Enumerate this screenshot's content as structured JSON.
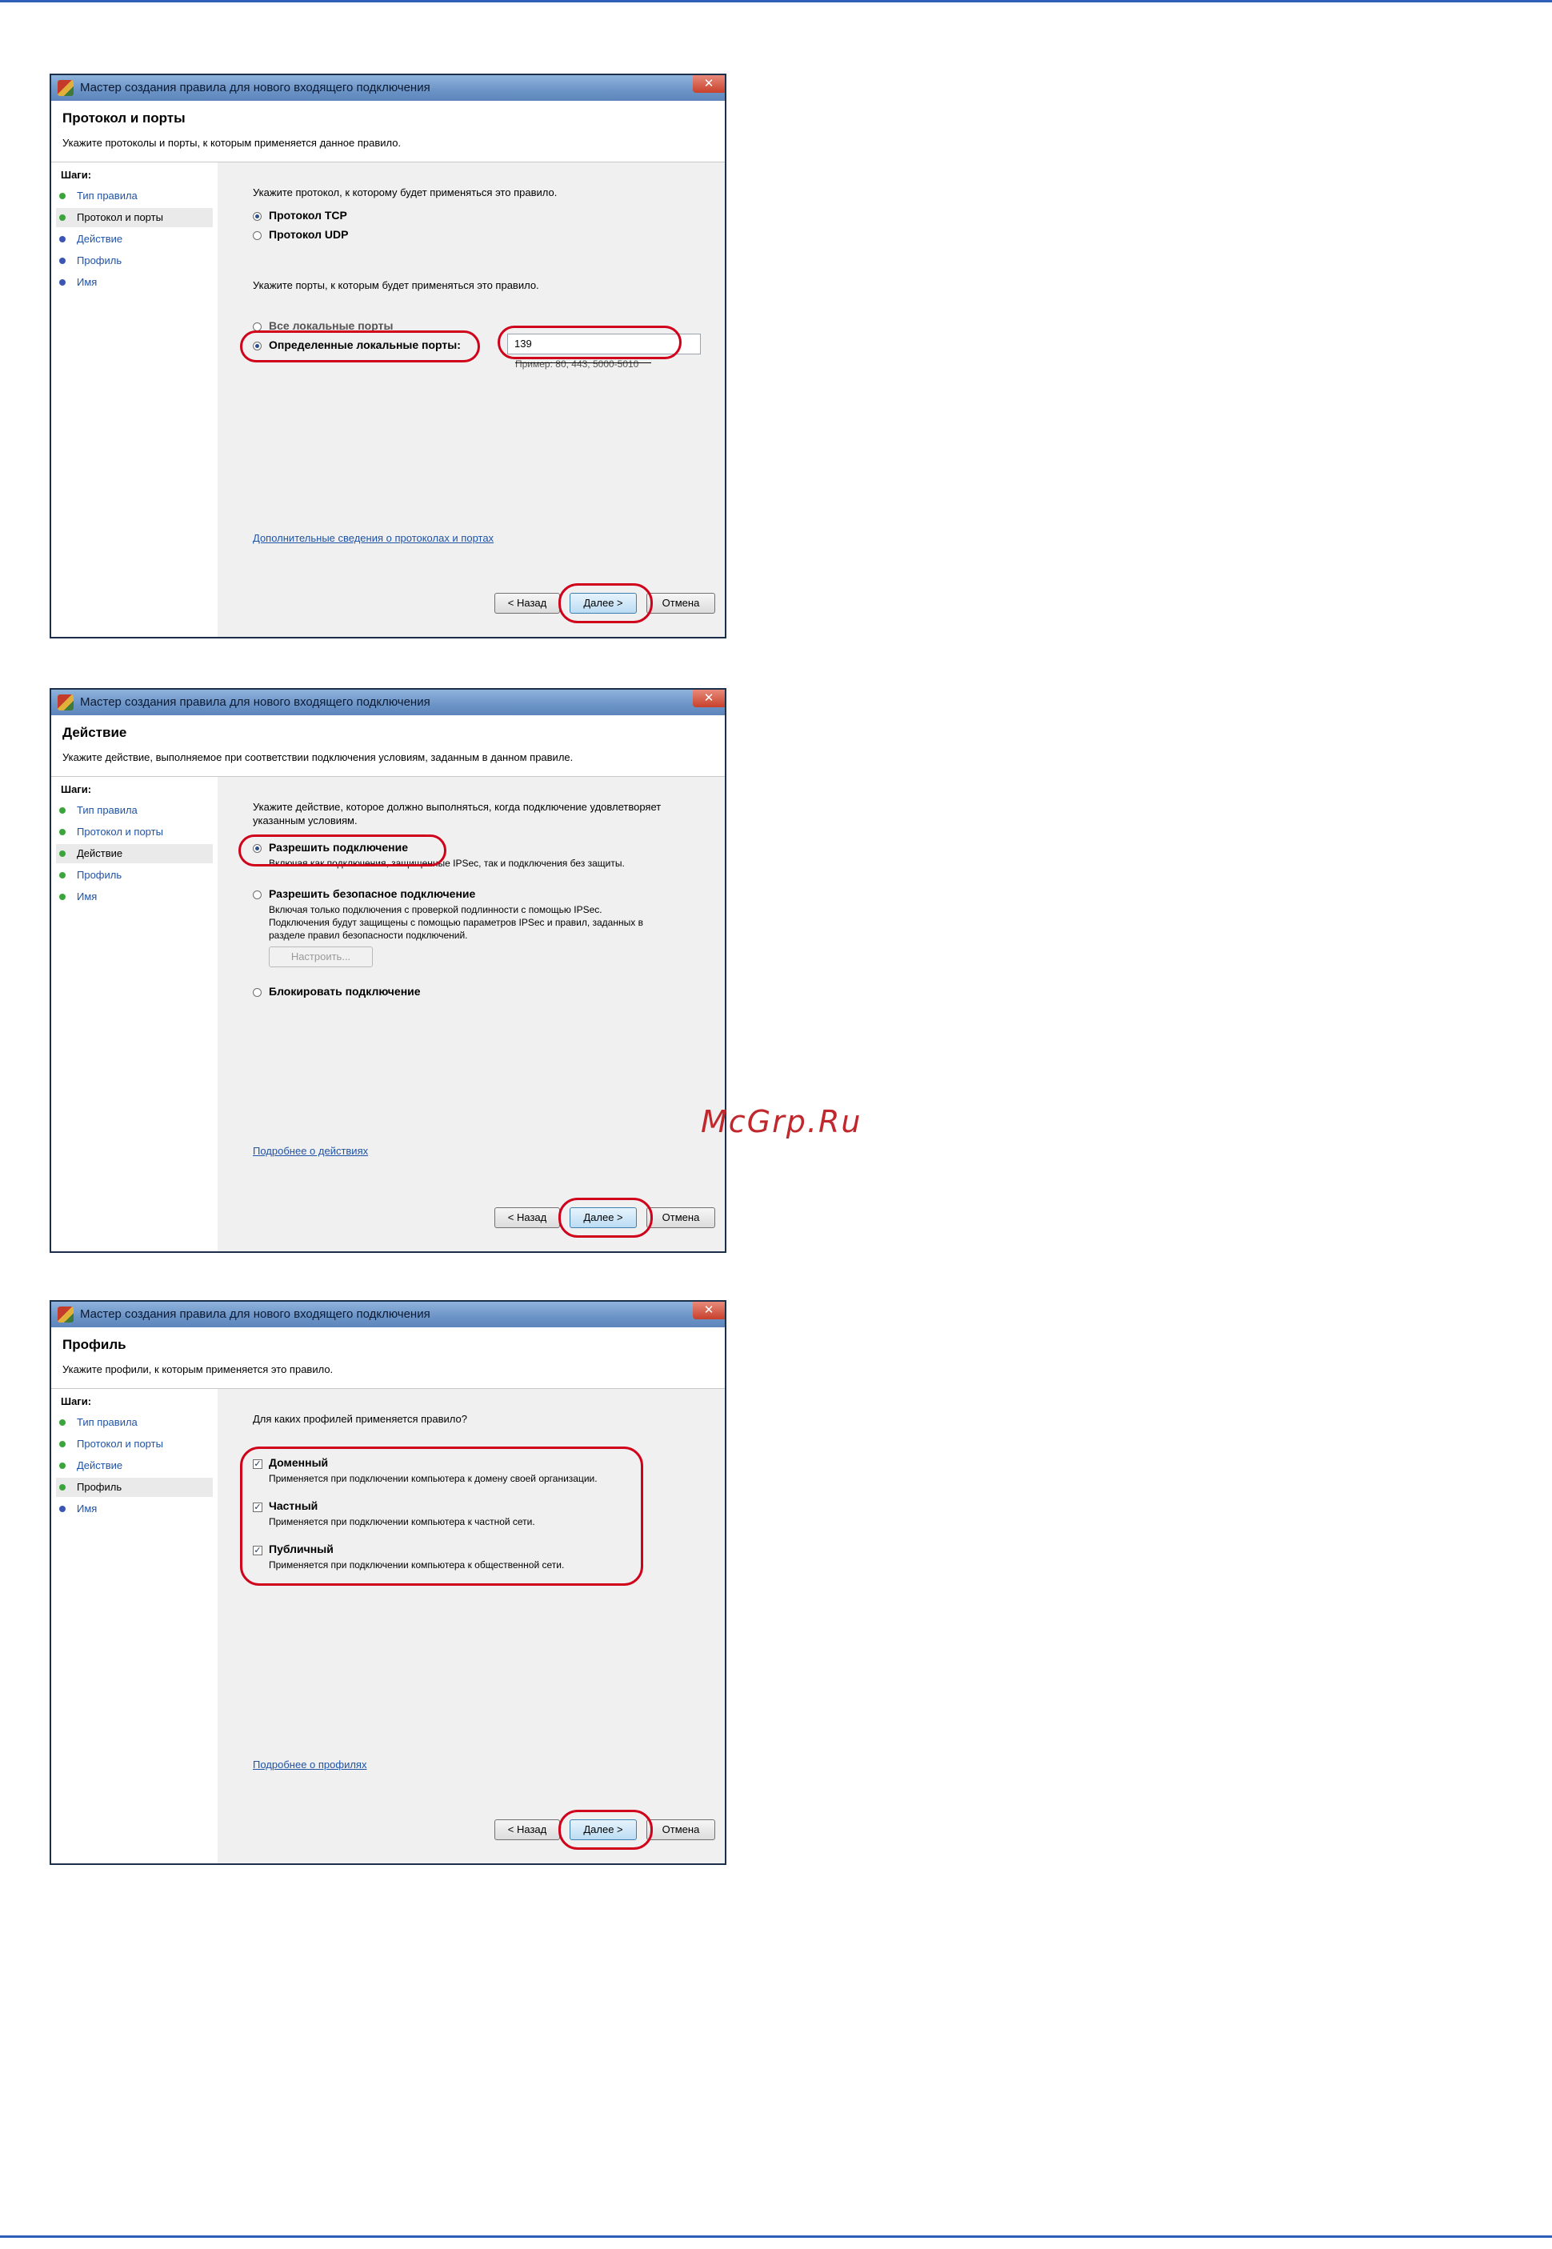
{
  "window_title": "Мастер создания правила для нового входящего подключения",
  "close_glyph": "✕",
  "steps_label": "Шаги:",
  "steps": [
    "Тип правила",
    "Протокол и порты",
    "Действие",
    "Профиль",
    "Имя"
  ],
  "buttons": {
    "back": "< Назад",
    "next": "Далее >",
    "cancel": "Отмена"
  },
  "highlight_color": "#d0021b",
  "watermark": "McGrp.Ru",
  "protocol_page": {
    "title": "Протокол и порты",
    "subtitle": "Укажите протоколы и порты, к которым применяется данное правило.",
    "protocol_question": "Укажите протокол, к которому будет применяться это правило.",
    "protocols": [
      {
        "label": "Протокол TCP",
        "selected": true
      },
      {
        "label": "Протокол UDP",
        "selected": false
      }
    ],
    "ports_question": "Укажите порты, к которым будет применяться это правило.",
    "all_ports": "Все локальные порты",
    "specific_ports": "Определенные локальные порты:",
    "ports_value": "139",
    "ports_example": "Пример: 80, 443, 5000-5010",
    "more_link": "Дополнительные сведения о протоколах и портах"
  },
  "action_page": {
    "title": "Действие",
    "subtitle": "Укажите действие, выполняемое при соответствии подключения условиям, заданным в данном правиле.",
    "question_line1": "Укажите действие, которое должно выполняться, когда подключение удовлетворяет",
    "question_line2": "указанным условиям.",
    "allow": "Разрешить подключение",
    "allow_desc": "Включая как подключения, защищенные IPSec, так и подключения без защиты.",
    "secure": "Разрешить безопасное подключение",
    "secure_desc1": "Включая только подключения с проверкой подлинности с помощью IPSec.",
    "secure_desc2": "Подключения будут защищены с помощью параметров IPSec и правил, заданных в",
    "secure_desc3": "разделе правил безопасности подключений.",
    "customize": "Настроить...",
    "block": "Блокировать подключение",
    "more_link": "Подробнее о действиях"
  },
  "profile_page": {
    "title": "Профиль",
    "subtitle": "Укажите профили, к которым применяется это правило.",
    "question": "Для каких профилей применяется правило?",
    "profiles": [
      {
        "label": "Доменный",
        "desc": "Применяется при подключении компьютера к домену своей организации.",
        "checked": true
      },
      {
        "label": "Частный",
        "desc": "Применяется при подключении компьютера к частной сети.",
        "checked": true
      },
      {
        "label": "Публичный",
        "desc": "Применяется при подключении компьютера к общественной сети.",
        "checked": true
      }
    ],
    "check_glyph": "✓",
    "more_link": "Подробнее о профилях"
  }
}
